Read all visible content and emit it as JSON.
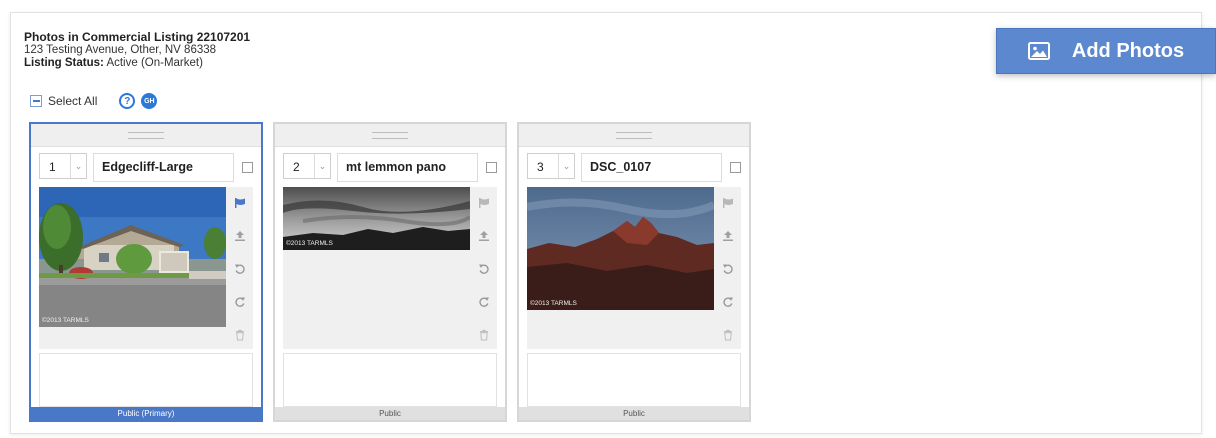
{
  "listing": {
    "title": "Photos in Commercial Listing 22107201",
    "address": "123 Testing Avenue, Other, NV 86338",
    "status_label": "Listing Status:",
    "status_value": "Active (On-Market)"
  },
  "toolbar": {
    "add_photos_label": "Add Photos",
    "select_all_label": "Select All",
    "help_glyph": "?",
    "gh_label": "GH"
  },
  "photos": [
    {
      "order": "1",
      "name": "Edgecliff-Large",
      "visibility": "Public (Primary)",
      "watermark": "©2013 TARMLS",
      "primary": true
    },
    {
      "order": "2",
      "name": "mt lemmon pano",
      "visibility": "Public",
      "watermark": "©2013 TARMLS",
      "primary": false
    },
    {
      "order": "3",
      "name": "DSC_0107",
      "visibility": "Public",
      "watermark": "©2013 TARMLS",
      "primary": false
    }
  ],
  "icons": {
    "add_photos": "image-icon",
    "tools": [
      "flag-icon",
      "upload-icon",
      "rotate-left-icon",
      "rotate-right-icon",
      "trash-icon"
    ]
  },
  "colors": {
    "accent": "#4a78c8",
    "button": "#5b88cf",
    "help": "#2b78d8",
    "primary_flag": "#4a78c8",
    "inactive_icon": "#b8b8b8"
  }
}
